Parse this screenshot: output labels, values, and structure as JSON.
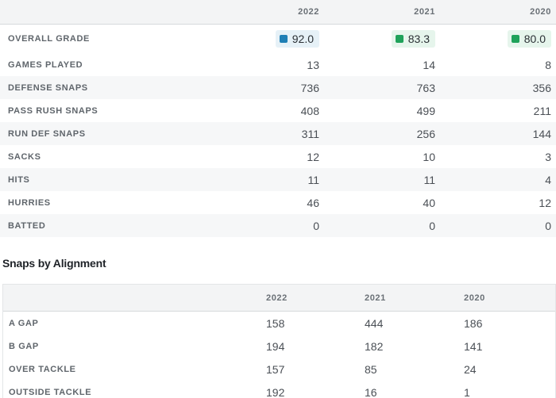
{
  "stats": {
    "years": [
      "2022",
      "2021",
      "2020"
    ],
    "overall_grade": {
      "label": "OVERALL GRADE",
      "values": [
        {
          "value": "92.0",
          "color": "#1f7fb5",
          "bg": "#e6f1f7"
        },
        {
          "value": "83.3",
          "color": "#1fa25a",
          "bg": "#e6f5ec"
        },
        {
          "value": "80.0",
          "color": "#1fa25a",
          "bg": "#e6f5ec"
        }
      ]
    },
    "rows": [
      {
        "label": "GAMES PLAYED",
        "values": [
          "13",
          "14",
          "8"
        ]
      },
      {
        "label": "DEFENSE SNAPS",
        "values": [
          "736",
          "763",
          "356"
        ]
      },
      {
        "label": "PASS RUSH SNAPS",
        "values": [
          "408",
          "499",
          "211"
        ]
      },
      {
        "label": "RUN DEF SNAPS",
        "values": [
          "311",
          "256",
          "144"
        ]
      },
      {
        "label": "SACKS",
        "values": [
          "12",
          "10",
          "3"
        ]
      },
      {
        "label": "HITS",
        "values": [
          "11",
          "11",
          "4"
        ]
      },
      {
        "label": "HURRIES",
        "values": [
          "46",
          "40",
          "12"
        ]
      },
      {
        "label": "BATTED",
        "values": [
          "0",
          "0",
          "0"
        ]
      }
    ]
  },
  "alignment": {
    "title": "Snaps by Alignment",
    "years": [
      "2022",
      "2021",
      "2020"
    ],
    "rows": [
      {
        "label": "A GAP",
        "values": [
          "158",
          "444",
          "186"
        ]
      },
      {
        "label": "B GAP",
        "values": [
          "194",
          "182",
          "141"
        ]
      },
      {
        "label": "OVER TACKLE",
        "values": [
          "157",
          "85",
          "24"
        ]
      },
      {
        "label": "OUTSIDE TACKLE",
        "values": [
          "192",
          "16",
          "1"
        ]
      }
    ]
  }
}
